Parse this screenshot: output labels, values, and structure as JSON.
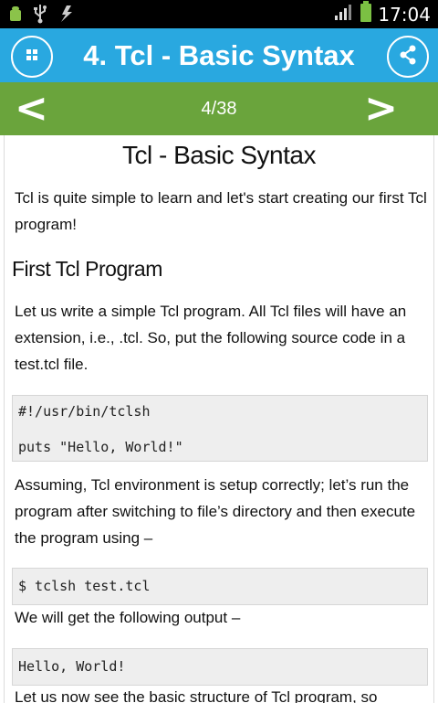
{
  "status_bar": {
    "time": "17:04",
    "icons": [
      "android-icon",
      "usb-icon",
      "data-icon",
      "signal-icon",
      "battery-icon"
    ]
  },
  "title_bar": {
    "title": "4. Tcl - Basic Syntax",
    "menu_icon": "grid-menu-icon",
    "share_icon": "share-icon",
    "color": "#29a8e0"
  },
  "nav_bar": {
    "prev_label": "<",
    "next_label": ">",
    "page_counter": "4/38",
    "color": "#6aa43c"
  },
  "content": {
    "heading": "Tcl - Basic Syntax",
    "intro": "Tcl is quite simple to learn and let's start creating our first Tcl program!",
    "section_heading": "First Tcl Program",
    "para1": "Let us write a simple Tcl program. All Tcl files will have an extension, i.e., .tcl. So, put the following source code in a test.tcl file.",
    "code1": [
      "#!/usr/bin/tclsh",
      "puts \"Hello, World!\""
    ],
    "para2": "Assuming, Tcl environment is setup correctly; let’s run the program after switching to file’s directory and then execute the program using –",
    "code2": "$ tclsh test.tcl",
    "para3": "We will get the following output –",
    "code3": "Hello, World!",
    "para4": "Let us now see the basic structure of Tcl program, so"
  }
}
